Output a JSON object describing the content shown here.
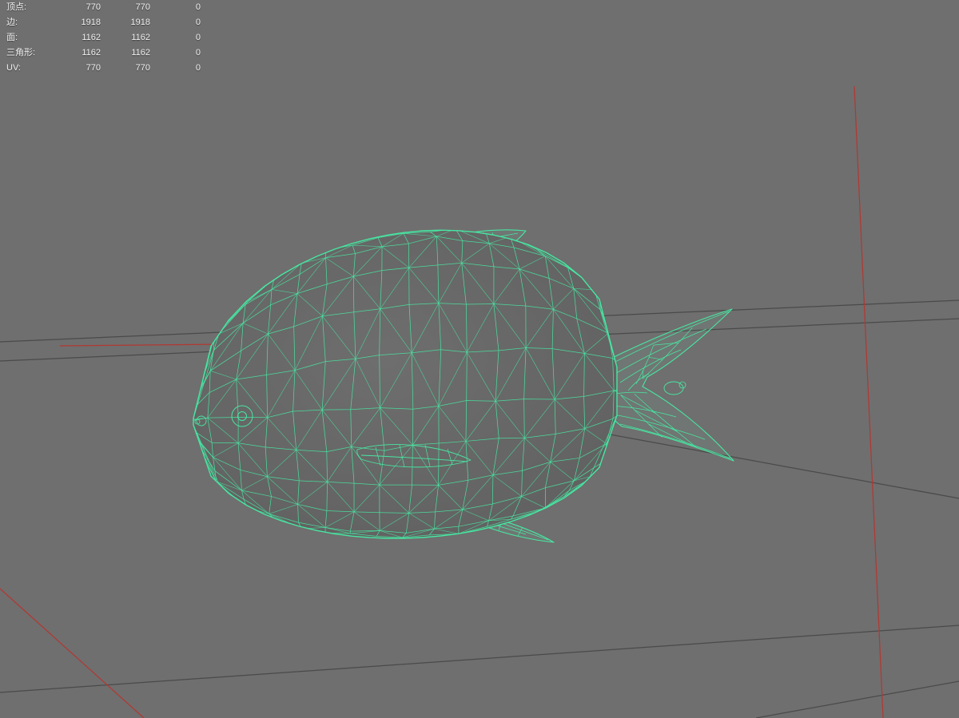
{
  "stats_panel": {
    "rows": [
      {
        "label": "顶点:",
        "values": [
          "770",
          "770",
          "0"
        ]
      },
      {
        "label": "边:",
        "values": [
          "1918",
          "1918",
          "0"
        ]
      },
      {
        "label": "面:",
        "values": [
          "1162",
          "1162",
          "0"
        ]
      },
      {
        "label": "三角形:",
        "values": [
          "1162",
          "1162",
          "0"
        ]
      },
      {
        "label": "UV:",
        "values": [
          "770",
          "770",
          "0"
        ]
      }
    ]
  },
  "viewport": {
    "background_color": "#6f6f6f",
    "grid_color": "#4a4a4a",
    "axis_color": "#b23832",
    "wireframe_color": "#47e7a2",
    "model": "fish-wireframe-mesh"
  }
}
